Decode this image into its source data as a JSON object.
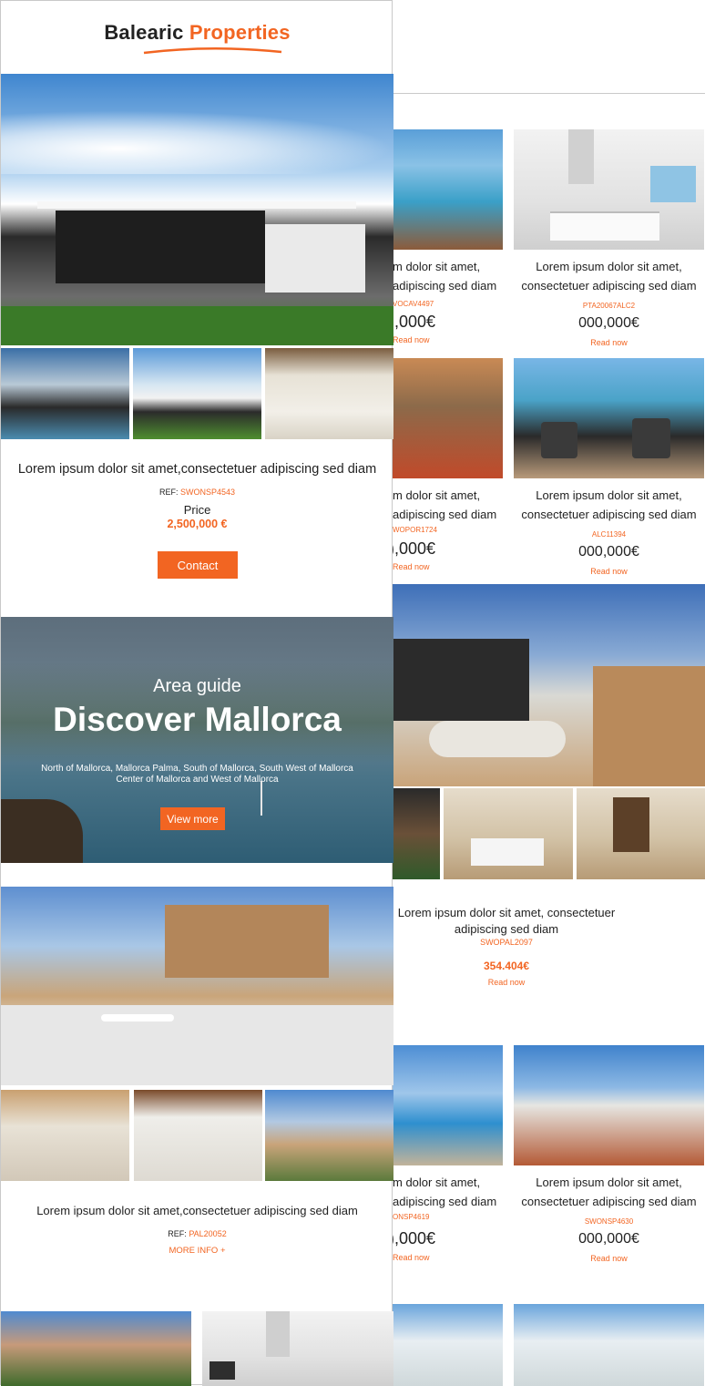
{
  "brand": {
    "name_part1": "Balearic",
    "name_part2": "Properties",
    "accent": "#f26522"
  },
  "right_listings": {
    "row1": [
      {
        "title_line1": "m dolor sit amet,",
        "title_line2": "adipiscing sed diam",
        "ref": "VOCAV4497",
        "price": "),000€",
        "link": "Read now"
      },
      {
        "title_line1": "Lorem ipsum dolor sit amet,",
        "title_line2": "consectetuer adipiscing sed diam",
        "ref": "PTA20067ALC2",
        "price": "000,000€",
        "link": "Read now"
      }
    ],
    "row2": [
      {
        "title_line1": "m dolor sit amet,",
        "title_line2": "adipiscing sed diam",
        "ref": "WOPOR1724",
        "price": "),000€",
        "link": "Read now"
      },
      {
        "title_line1": "Lorem ipsum dolor sit amet,",
        "title_line2": "consectetuer adipiscing sed diam",
        "ref": "ALC11394",
        "price": "000,000€",
        "link": "Read now"
      }
    ],
    "feature": {
      "title_line1": "Lorem ipsum dolor sit amet, consectetuer",
      "title_line2": "adipiscing sed diam",
      "ref": "SWOPAL2097",
      "price": "354.404€",
      "link": "Read now"
    },
    "row3": [
      {
        "title_line1": "m dolor sit amet,",
        "title_line2": "adipiscing sed diam",
        "ref": "ONSP4619",
        "price": "),000€",
        "link": "Read now"
      },
      {
        "title_line1": "Lorem ipsum dolor sit amet,",
        "title_line2": "consectetuer adipiscing sed diam",
        "ref": "SWONSP4630",
        "price": "000,000€",
        "link": "Read now"
      }
    ]
  },
  "featured_property": {
    "title": "Lorem ipsum dolor sit amet,consectetuer adipiscing sed diam",
    "ref_label": "REF:",
    "ref": "SWONSP4543",
    "price_label": "Price",
    "price": "2,500,000 €",
    "contact_button": "Contact"
  },
  "area_guide": {
    "kicker": "Area guide",
    "title": "Discover Mallorca",
    "areas_line1": "North of Mallorca, Mallorca Palma, South of Mallorca, South West of Mallorca",
    "areas_line2": "Center of Mallorca and West of Mallorca",
    "button": "View more"
  },
  "second_property": {
    "title": "Lorem ipsum dolor sit amet,consectetuer adipiscing sed diam",
    "ref_label": "REF:",
    "ref": "PAL20052",
    "more_info": "MORE INFO +"
  }
}
